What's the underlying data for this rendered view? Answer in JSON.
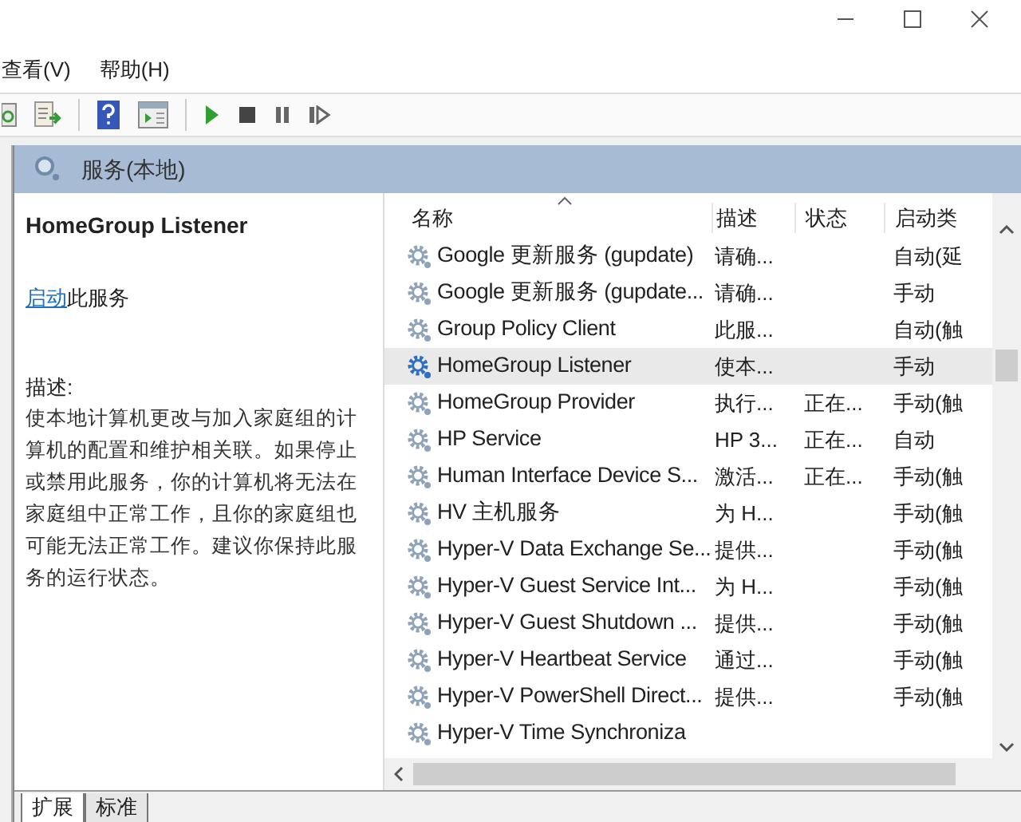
{
  "menu": [
    {
      "label": "查看(V)"
    },
    {
      "label": "帮助(H)"
    }
  ],
  "panel_title": "服务(本地)",
  "details": {
    "title": "HomeGroup Listener",
    "action_link": "启动",
    "action_text": "此服务",
    "description_label": "描述:",
    "description": "使本地计算机更改与加入家庭组的计算机的配置和维护相关联。如果停止或禁用此服务，你的计算机将无法在家庭组中正常工作，且你的家庭组也可能无法正常工作。建议你保持此服务的运行状态。"
  },
  "table": {
    "columns": [
      "名称",
      "描述",
      "状态",
      "启动类"
    ],
    "rows": [
      {
        "name": "Google 更新服务 (gupdate)",
        "description": "请确...",
        "status": "",
        "startup": "自动(延",
        "selected": false
      },
      {
        "name": "Google 更新服务 (gupdate...",
        "description": "请确...",
        "status": "",
        "startup": "手动",
        "selected": false
      },
      {
        "name": "Group Policy Client",
        "description": "此服...",
        "status": "",
        "startup": "自动(触",
        "selected": false
      },
      {
        "name": "HomeGroup Listener",
        "description": "使本...",
        "status": "",
        "startup": "手动",
        "selected": true
      },
      {
        "name": "HomeGroup Provider",
        "description": "执行...",
        "status": "正在...",
        "startup": "手动(触",
        "selected": false
      },
      {
        "name": "HP Service",
        "description": "HP 3...",
        "status": "正在...",
        "startup": "自动",
        "selected": false
      },
      {
        "name": "Human Interface Device S...",
        "description": "激活...",
        "status": "正在...",
        "startup": "手动(触",
        "selected": false
      },
      {
        "name": "HV 主机服务",
        "description": "为 H...",
        "status": "",
        "startup": "手动(触",
        "selected": false
      },
      {
        "name": "Hyper-V Data Exchange Se...",
        "description": "提供...",
        "status": "",
        "startup": "手动(触",
        "selected": false
      },
      {
        "name": "Hyper-V Guest Service Int...",
        "description": "为 H...",
        "status": "",
        "startup": "手动(触",
        "selected": false
      },
      {
        "name": "Hyper-V Guest Shutdown ...",
        "description": "提供...",
        "status": "",
        "startup": "手动(触",
        "selected": false
      },
      {
        "name": "Hyper-V Heartbeat Service",
        "description": "通过...",
        "status": "",
        "startup": "手动(触",
        "selected": false
      },
      {
        "name": "Hyper-V PowerShell Direct...",
        "description": "提供...",
        "status": "",
        "startup": "手动(触",
        "selected": false
      },
      {
        "name": "Hyper-V Time Synchroniza",
        "description": "",
        "status": "",
        "startup": "",
        "selected": false
      }
    ]
  },
  "bottom_tabs": [
    {
      "label": "扩展",
      "selected": true
    },
    {
      "label": "标准",
      "selected": false
    }
  ]
}
